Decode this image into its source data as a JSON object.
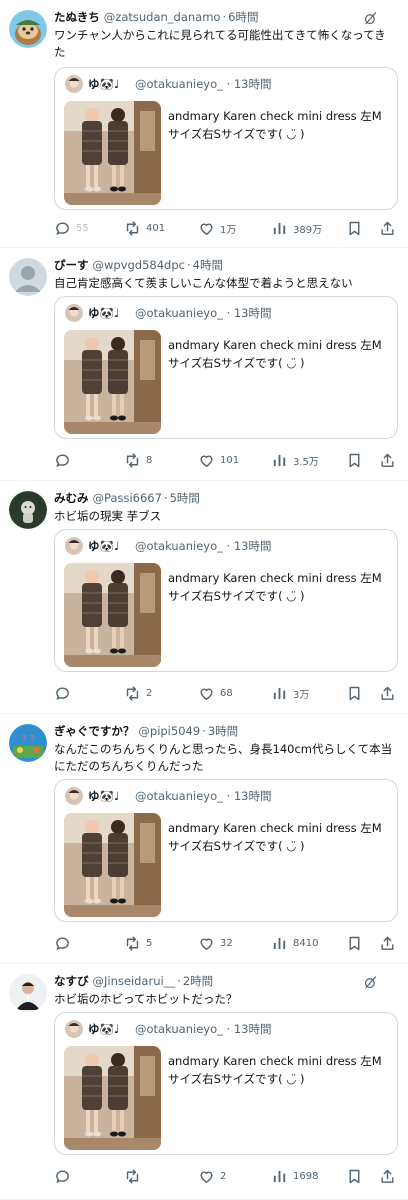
{
  "quoted_tweet": {
    "name": "ゆ🐼♩",
    "handle": "@otakuanieyo_",
    "time": "13時間",
    "text": "andmary Karen check mini dress 左Mサイズ右Sサイズです( ◡̈ )"
  },
  "posts": [
    {
      "name": "たぬきち",
      "handle": "@zatsudan_danamo",
      "time": "6時間",
      "text": "ワンチャン人からこれに見られてる可能性出てきて怖くなってきた",
      "replies": "55",
      "retweets": "401",
      "likes": "1万",
      "views": "389万",
      "grok": true
    },
    {
      "name": "ぴーす",
      "handle": "@wpvgd584dpc",
      "time": "4時間",
      "text": "自己肯定感高くて羨ましいこんな体型で着ようと思えない",
      "replies": "",
      "retweets": "8",
      "likes": "101",
      "views": "3.5万",
      "grok": false
    },
    {
      "name": "みむみ",
      "handle": "@Passi6667",
      "time": "5時間",
      "text": "ホビ垢の現実 芋ブス",
      "replies": "",
      "retweets": "2",
      "likes": "68",
      "views": "3万",
      "grok": false
    },
    {
      "name": "ぎゃぐですか？",
      "handle": "@pipi5049",
      "time": "3時間",
      "text": "なんだこのちんちくりんと思ったら、身長140cm代らしくて本当にただのちんちくりんだった",
      "replies": "",
      "retweets": "5",
      "likes": "32",
      "views": "8410",
      "grok": false
    },
    {
      "name": "なすび",
      "handle": "@Jinseidarui__",
      "time": "2時間",
      "text": "ホビ垢のホビってホビットだった？",
      "replies": "",
      "retweets": "",
      "likes": "2",
      "views": "1698",
      "grok": true
    }
  ],
  "colors": {
    "text": "#0f1419",
    "muted": "#536471",
    "border": "#cfd9de",
    "divider": "#eff3f4"
  },
  "icons": [
    "reply-icon",
    "retweet-icon",
    "like-icon",
    "views-icon",
    "bookmark-icon",
    "share-icon",
    "grok-icon"
  ]
}
